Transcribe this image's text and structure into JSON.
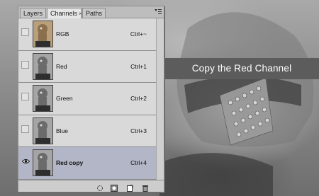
{
  "caption": "Copy the Red Channel",
  "panel": {
    "tabs": [
      {
        "label": "Layers",
        "active": false
      },
      {
        "label": "Channels",
        "active": true,
        "close": "×"
      },
      {
        "label": "Paths",
        "active": false
      }
    ],
    "menu_icon": "panel-menu-icon",
    "channels": [
      {
        "name": "RGB",
        "shortcut": "Ctrl+~",
        "visible": false,
        "selected": false,
        "thumb": "color"
      },
      {
        "name": "Red",
        "shortcut": "Ctrl+1",
        "visible": false,
        "selected": false,
        "thumb": "gray"
      },
      {
        "name": "Green",
        "shortcut": "Ctrl+2",
        "visible": false,
        "selected": false,
        "thumb": "gray"
      },
      {
        "name": "Blue",
        "shortcut": "Ctrl+3",
        "visible": false,
        "selected": false,
        "thumb": "gray"
      },
      {
        "name": "Red copy",
        "shortcut": "Ctrl+4",
        "visible": true,
        "selected": true,
        "thumb": "gray"
      }
    ],
    "footer_icons": [
      "load-selection-icon",
      "save-selection-icon",
      "new-channel-icon",
      "delete-channel-icon"
    ]
  },
  "colors": {
    "selected_row": "#b3b6c6",
    "caption_bg": "#5c5c5c"
  }
}
